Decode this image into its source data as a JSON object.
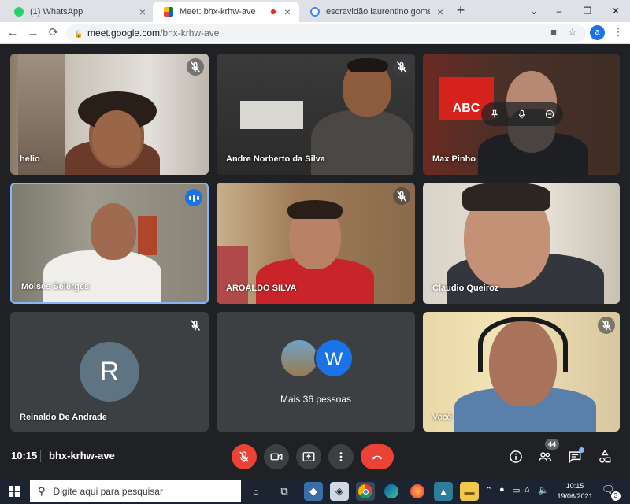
{
  "browser": {
    "tabs": [
      {
        "label": "(1) WhatsApp",
        "active": false
      },
      {
        "label": "Meet: bhx-krhw-ave",
        "active": true
      },
      {
        "label": "escravidão laurentino gomes - Pe",
        "active": false
      }
    ],
    "new_tab": "+",
    "url_host": "meet.google.com",
    "url_path": "/bhx-krhw-ave",
    "profile_initial": "a",
    "window_controls": {
      "minimize": "–",
      "maximize": "❐",
      "close": "✕"
    },
    "nav": {
      "back": "←",
      "forward": "→",
      "reload": "⟳"
    }
  },
  "meeting": {
    "time": "10:15",
    "code": "bhx-krhw-ave",
    "participants": [
      {
        "name": "helio",
        "muted": true
      },
      {
        "name": "Andre Norberto da Silva",
        "muted": true
      },
      {
        "name": "Max Pinho",
        "muted": false
      },
      {
        "name": "Moises Selerges",
        "muted": false,
        "speaking": true
      },
      {
        "name": "AROALDO SILVA",
        "muted": true
      },
      {
        "name": "Claudio Queiroz",
        "muted": false
      },
      {
        "name": "Reinaldo De Andrade",
        "muted": true,
        "avatar_initial": "R"
      },
      {
        "name": "Você",
        "muted": true
      }
    ],
    "overflow": {
      "label": "Mais 36 pessoas",
      "avatar_initial": "W"
    },
    "participant_count": "44",
    "brand_logo_text": "ABC"
  },
  "taskbar": {
    "search_placeholder": "Digite aqui para pesquisar",
    "time": "10:15",
    "date": "19/06/2021",
    "notifications": "3"
  },
  "colors": {
    "meet_bg": "#202124",
    "tile_bg": "#3c4043",
    "hangup_red": "#ea4335",
    "speaking_blue": "#1a73e8",
    "avatar_slate": "#5f7482"
  }
}
